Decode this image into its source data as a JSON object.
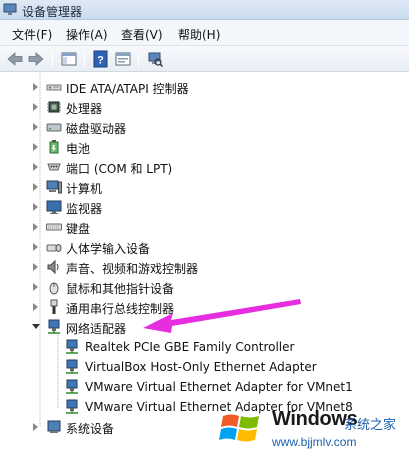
{
  "window": {
    "title": "设备管理器"
  },
  "menu": {
    "items": [
      "文件(F)",
      "操作(A)",
      "查看(V)",
      "帮助(H)"
    ]
  },
  "tree": {
    "items": [
      {
        "label": "IDE ATA/ATAPI 控制器",
        "icon": "ide-controller-icon"
      },
      {
        "label": "处理器",
        "icon": "processor-icon"
      },
      {
        "label": "磁盘驱动器",
        "icon": "disk-drive-icon"
      },
      {
        "label": "电池",
        "icon": "battery-icon"
      },
      {
        "label": "端口 (COM 和 LPT)",
        "icon": "port-icon"
      },
      {
        "label": "计算机",
        "icon": "computer-icon"
      },
      {
        "label": "监视器",
        "icon": "monitor-icon"
      },
      {
        "label": "键盘",
        "icon": "keyboard-icon"
      },
      {
        "label": "人体学输入设备",
        "icon": "hid-icon"
      },
      {
        "label": "声音、视频和游戏控制器",
        "icon": "sound-icon"
      },
      {
        "label": "鼠标和其他指针设备",
        "icon": "mouse-icon"
      },
      {
        "label": "通用串行总线控制器",
        "icon": "usb-icon"
      },
      {
        "label": "网络适配器",
        "icon": "network-adapter-icon",
        "expanded": true
      },
      {
        "label": "Realtek PCIe GBE Family Controller",
        "icon": "network-adapter-icon",
        "child": true
      },
      {
        "label": "VirtualBox Host-Only Ethernet Adapter",
        "icon": "network-adapter-icon",
        "child": true
      },
      {
        "label": "VMware Virtual Ethernet Adapter for VMnet1",
        "icon": "network-adapter-icon",
        "child": true
      },
      {
        "label": "VMware Virtual Ethernet Adapter for VMnet8",
        "icon": "network-adapter-icon",
        "child": true
      },
      {
        "label": "系统设备",
        "icon": "system-device-icon"
      }
    ]
  },
  "watermark": {
    "title": "Windows",
    "subtitle": "系统之家",
    "url": "www.bjjmlv.com"
  },
  "colors": {
    "arrow": "#e62ee0",
    "accent": "#1a5fae"
  }
}
